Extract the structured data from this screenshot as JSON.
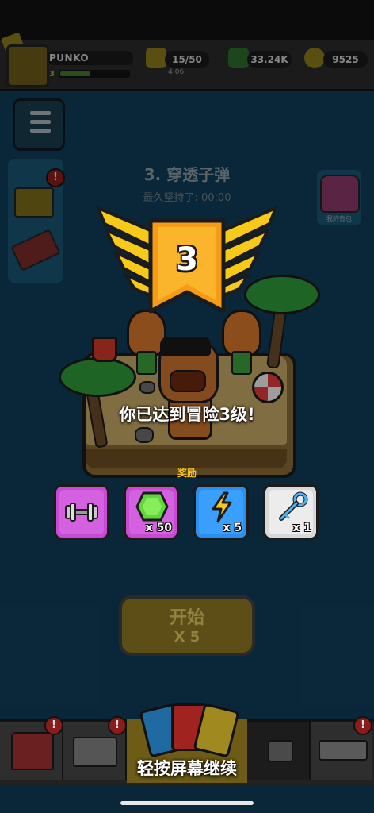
{
  "player": {
    "name": "PUNKO",
    "level": "3"
  },
  "resources": {
    "energy": "15/50",
    "energy_timer": "4:06",
    "cash": "33.24K",
    "coins": "9525"
  },
  "stage": {
    "title": "3. 穿透子弹",
    "subtitle": "最久坚持了:  00:00"
  },
  "side": {
    "backpack_label": "我的背包"
  },
  "levelup": {
    "level": "3",
    "message": "你已达到冒险3级!",
    "rewards_label": "奖励",
    "rewards": [
      {
        "icon": "dumbbell-icon",
        "qty": "",
        "color": "#c84bd6"
      },
      {
        "icon": "green-gem-icon",
        "qty": "x 50",
        "color": "#c84bd6"
      },
      {
        "icon": "energy-bolt-icon",
        "qty": "x 5",
        "color": "#2b8ff0"
      },
      {
        "icon": "key-icon",
        "qty": "x 1",
        "color": "#d8d8d8"
      }
    ]
  },
  "start_button": {
    "label": "开始",
    "cost": "X 5"
  },
  "tabs": {
    "badge": "!"
  },
  "continue_text": "轻按屏幕继续",
  "colors": {
    "gold": "#f4c21f",
    "orange_banner": "#f59c14",
    "purple_card": "#c84bd6",
    "blue_card": "#2b8ff0",
    "gray_card": "#d8d8d8"
  }
}
